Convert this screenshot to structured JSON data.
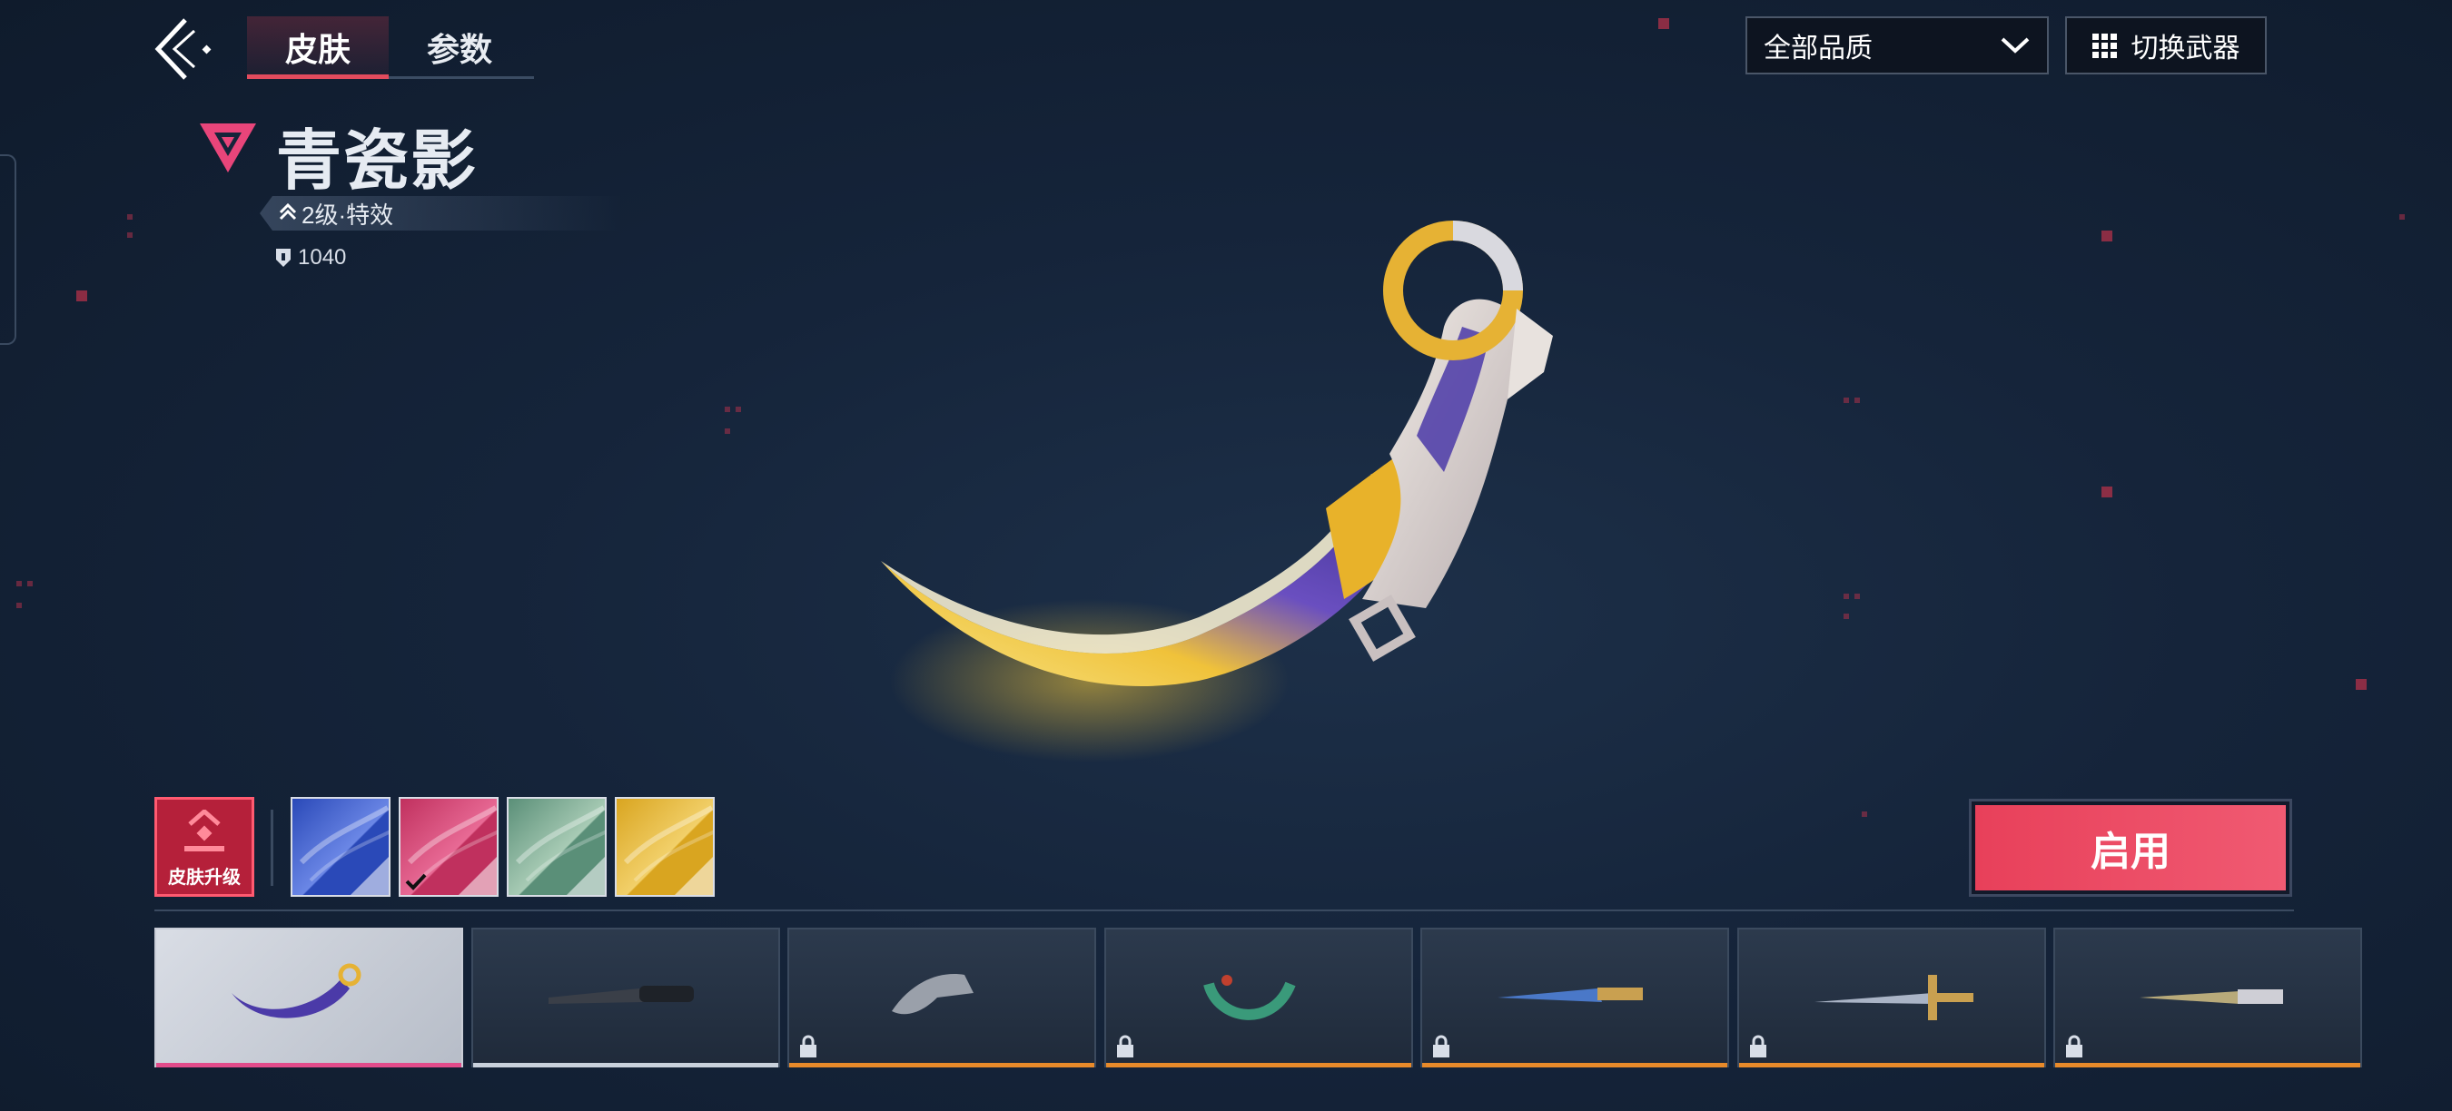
{
  "header": {
    "tabs": [
      {
        "label": "皮肤",
        "active": true
      },
      {
        "label": "参数",
        "active": false
      }
    ],
    "quality_filter": {
      "selected": "全部品质",
      "icon": "chevron-down-icon"
    },
    "switch_weapon_label": "切换武器"
  },
  "skin": {
    "name": "青瓷影",
    "level": "2级·特效",
    "price": "1040",
    "tier_color": "#e8457a"
  },
  "variants": {
    "upgrade_label": "皮肤升级",
    "swatches": [
      {
        "name": "blue",
        "colors": [
          "#2a49b8",
          "#6b87e6"
        ],
        "selected": false
      },
      {
        "name": "pink",
        "colors": [
          "#c0305e",
          "#e86a95"
        ],
        "selected": true
      },
      {
        "name": "green",
        "colors": [
          "#5a8f78",
          "#a8cbb5"
        ],
        "selected": false
      },
      {
        "name": "gold",
        "colors": [
          "#d9a520",
          "#f2d06a"
        ],
        "selected": false
      }
    ]
  },
  "enable_button_label": "启用",
  "weapons": [
    {
      "name": "karambit",
      "selected": true,
      "locked": false,
      "bar_color": "#e24b8a"
    },
    {
      "name": "combat-knife",
      "selected": false,
      "locked": false,
      "bar_color": "#c9d1dc"
    },
    {
      "name": "folding-karambit",
      "selected": false,
      "locked": true,
      "bar_color": "#e88a2a"
    },
    {
      "name": "jade-ring-blade",
      "selected": false,
      "locked": true,
      "bar_color": "#e88a2a"
    },
    {
      "name": "blue-dagger",
      "selected": false,
      "locked": true,
      "bar_color": "#e88a2a"
    },
    {
      "name": "ornate-sword",
      "selected": false,
      "locked": true,
      "bar_color": "#e88a2a"
    },
    {
      "name": "serrated-knife",
      "selected": false,
      "locked": true,
      "bar_color": "#e88a2a"
    }
  ]
}
